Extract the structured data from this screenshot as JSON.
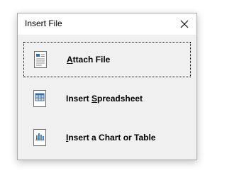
{
  "window": {
    "title": "Insert File",
    "close_icon": "close-icon"
  },
  "options": [
    {
      "name": "attach-file",
      "icon": "document-icon",
      "label_pre": "",
      "label_key": "A",
      "label_post": "ttach File",
      "focused": true
    },
    {
      "name": "insert-spreadsheet",
      "icon": "spreadsheet-icon",
      "label_pre": "Insert ",
      "label_key": "S",
      "label_post": "preadsheet",
      "focused": false
    },
    {
      "name": "insert-chart-table",
      "icon": "chart-icon",
      "label_pre": "",
      "label_key": "I",
      "label_post": "nsert a Chart or Table",
      "focused": false
    }
  ],
  "colors": {
    "dialog_bg": "#f0f0f0",
    "titlebar_bg": "#ffffff",
    "icon_blue": "#2f6eb5"
  }
}
